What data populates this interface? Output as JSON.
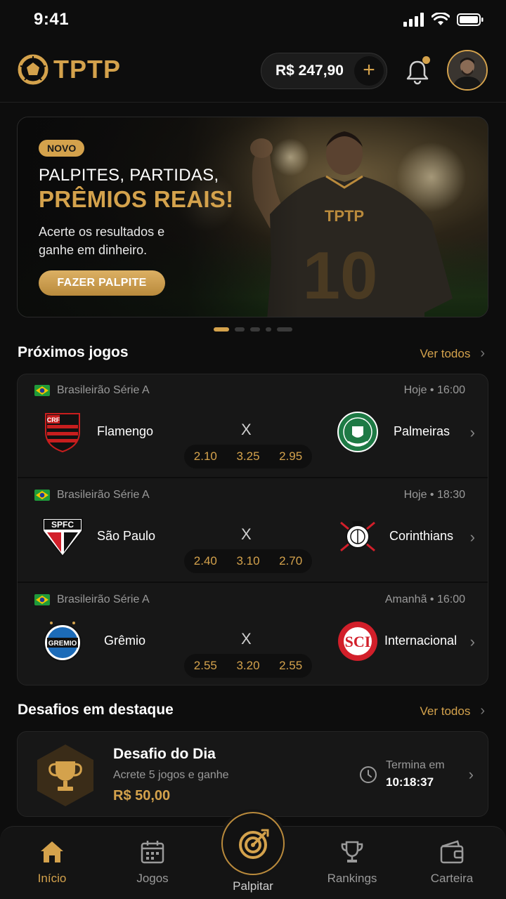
{
  "status_bar": {
    "time": "9:41"
  },
  "header": {
    "logo_text": "TPTP",
    "balance": "R$ 247,90",
    "add_funds_symbol": "+",
    "icons": {
      "logo": "tptp-logo-icon",
      "bell": "bell-icon",
      "avatar": "avatar"
    }
  },
  "banner": {
    "badge": "NOVO",
    "title_line1": "PALPITES, PARTIDAS,",
    "title_line2": "PRÊMIOS REAIS!",
    "description": "Acerte os resultados e ganhe em dinheiro.",
    "cta_label": "FAZER PALPITE",
    "jersey_brand": "TPTP",
    "jersey_number": "10",
    "active_slide": 1,
    "slide_count": 5
  },
  "upcoming": {
    "title": "Próximos jogos",
    "see_all": "Ver todos",
    "matches": [
      {
        "league": "Brasileirão Série A",
        "when": "Hoje • 16:00",
        "home": "Flamengo",
        "away": "Palmeiras",
        "vs": "X",
        "odds": [
          "2.10",
          "3.25",
          "2.95"
        ]
      },
      {
        "league": "Brasileirão Série A",
        "when": "Hoje • 18:30",
        "home": "São Paulo",
        "away": "Corinthians",
        "vs": "X",
        "odds": [
          "2.40",
          "3.10",
          "2.70"
        ]
      },
      {
        "league": "Brasileirão Série A",
        "when": "Amanhã • 16:00",
        "home": "Grêmio",
        "away": "Internacional",
        "vs": "X",
        "odds": [
          "2.55",
          "3.20",
          "2.55"
        ]
      }
    ]
  },
  "challenges": {
    "title": "Desafios em destaque",
    "see_all": "Ver todos",
    "featured": {
      "name": "Desafio do Dia",
      "subtitle": "Acrete 5 jogos e ganhe",
      "prize": "R$ 50,00",
      "ends_label": "Termina em",
      "ends_time": "10:18:37"
    }
  },
  "crest_text": {
    "sao_paulo": "SPFC",
    "gremio": "GREMIO"
  },
  "bottom_nav": {
    "items": [
      {
        "label": "Início",
        "icon": "home-icon",
        "active": true
      },
      {
        "label": "Jogos",
        "icon": "calendar-icon",
        "active": false
      },
      {
        "label": "Palpitar",
        "icon": "target-icon",
        "active": false
      },
      {
        "label": "Rankings",
        "icon": "trophy-icon",
        "active": false
      },
      {
        "label": "Carteira",
        "icon": "wallet-icon",
        "active": false
      }
    ]
  },
  "colors": {
    "accent": "#d4a24c",
    "background": "#0d0d0d",
    "card": "#171717"
  }
}
